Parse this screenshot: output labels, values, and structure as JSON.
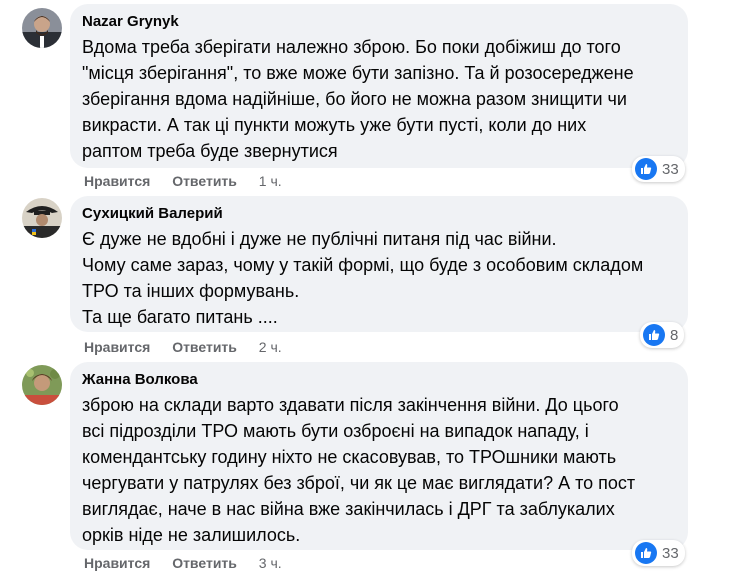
{
  "comments": [
    {
      "author": "Nazar Grynyk",
      "lines": [
        "Вдома треба зберігати належно зброю. Бо поки добіжиш до того",
        "\"місця зберігання\", то вже може бути запізно. Та й розосереджене",
        "зберігання вдома надійніше, бо його не можна разом знищити чи",
        "викрасти. А так ці пункти можуть уже бути пусті, коли до них",
        "раптом треба буде звернутися"
      ],
      "likes": "33",
      "like_label": "Нравится",
      "reply_label": "Ответить",
      "time": "1 ч."
    },
    {
      "author": "Сухицкий Валерий",
      "lines": [
        "Є дуже не вдобні і дуже не публічні питаня під час війни.",
        "Чому саме зараз, чому у такій формі, що буде з особовим складом",
        "ТРО та інших формувань.",
        "Та ще багато питань ...."
      ],
      "likes": "8",
      "like_label": "Нравится",
      "reply_label": "Ответить",
      "time": "2 ч."
    },
    {
      "author": "Жанна Волкова",
      "lines": [
        "зброю на склади варто здавати після закінчення війни. До цього",
        "всі підрозділи ТРО мають бути озброєні на випадок нападу, і",
        "комендантську годину ніхто не скасовував, то ТРОшники мають",
        "чергувати у патрулях без зброї, чи як це має виглядати? А то пост",
        "виглядає, наче в нас війна вже закінчилась і ДРГ та заблукалих",
        "орків ніде не залишилось."
      ],
      "likes": "33",
      "like_label": "Нравится",
      "reply_label": "Ответить",
      "time": "3 ч."
    }
  ],
  "colors": {
    "bubble": "#f0f2f5",
    "like": "#1877f2",
    "meta": "#65676b"
  }
}
